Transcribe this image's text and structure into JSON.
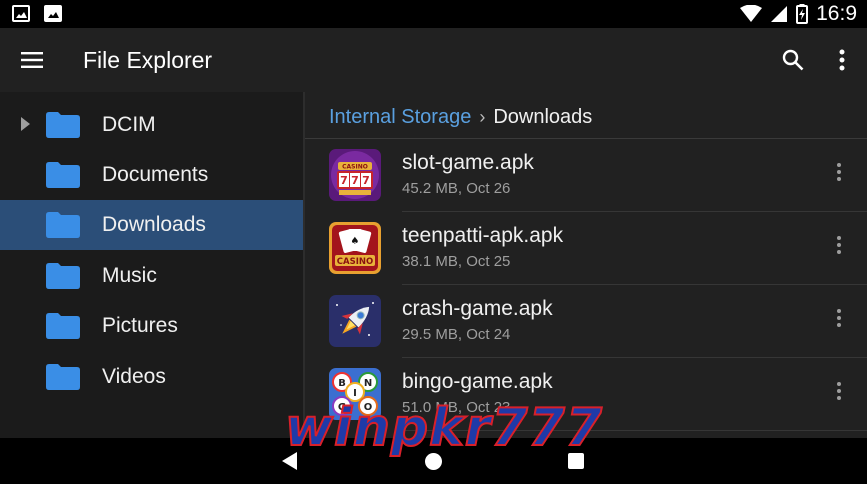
{
  "status_bar": {
    "time": "16:9",
    "icons": [
      "image-icon",
      "image-filled-icon",
      "wifi-icon",
      "signal-icon",
      "battery-icon"
    ]
  },
  "app_bar": {
    "title": "File Explorer",
    "icons": [
      "menu-icon",
      "search-icon",
      "more-vert-icon"
    ]
  },
  "sidebar": {
    "items": [
      {
        "label": "DCIM",
        "active": false,
        "expandable": true
      },
      {
        "label": "Documents",
        "active": false
      },
      {
        "label": "Downloads",
        "active": true
      },
      {
        "label": "Music",
        "active": false
      },
      {
        "label": "Pictures",
        "active": false
      },
      {
        "label": "Videos",
        "active": false
      }
    ],
    "folder_color": "#3a8ee6",
    "active_color": "#2b4e78"
  },
  "breadcrumb": {
    "root": "Internal Storage",
    "separator": "›",
    "current": "Downloads"
  },
  "files": [
    {
      "name": "slot-game.apk",
      "meta": "45.2 MB, Oct 26",
      "icon": "casino-slot-icon"
    },
    {
      "name": "teenpatti-apk.apk",
      "meta": "38.1 MB, Oct 25",
      "icon": "casino-cards-icon"
    },
    {
      "name": "crash-game.apk",
      "meta": "29.5 MB, Oct 24",
      "icon": "rocket-icon"
    },
    {
      "name": "bingo-game.apk",
      "meta": "51.0 MB, Oct 23",
      "icon": "bingo-balls-icon"
    }
  ],
  "watermark": "winpkr777",
  "nav_bar": {
    "icons": [
      "back-icon",
      "home-icon",
      "recents-icon"
    ]
  }
}
